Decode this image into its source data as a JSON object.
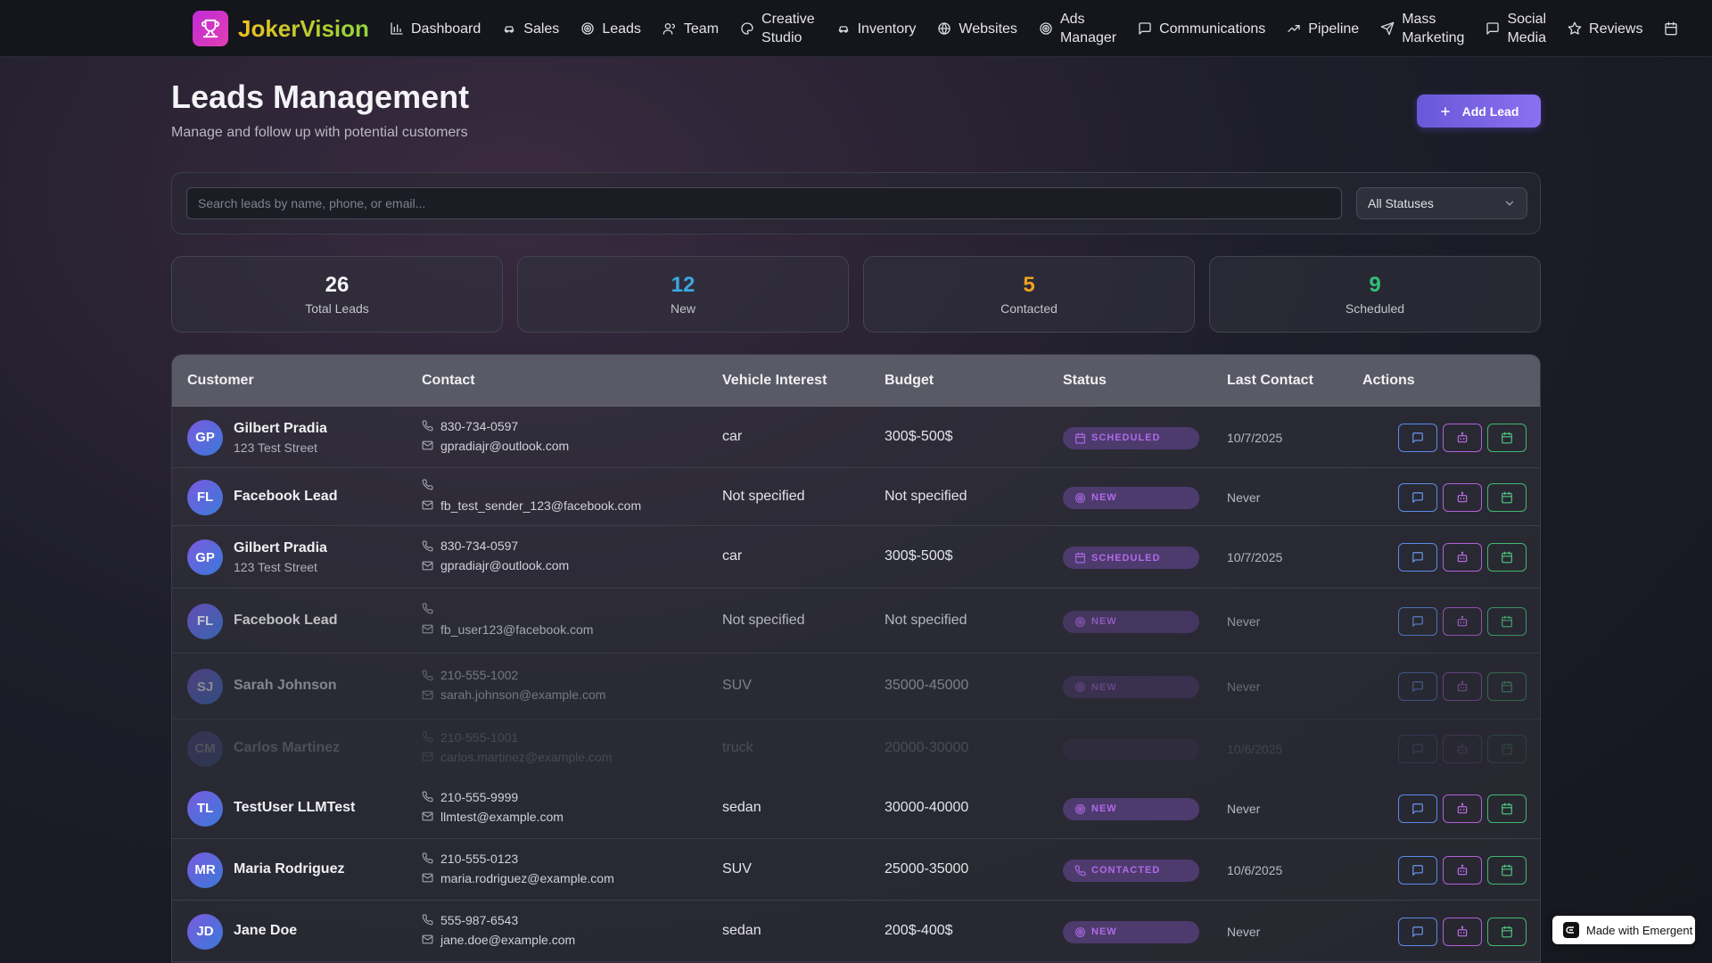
{
  "app": {
    "name": "JokerVision"
  },
  "nav": [
    {
      "label": "Dashboard",
      "icon": "bar-chart-icon"
    },
    {
      "label": "Sales",
      "icon": "car-icon"
    },
    {
      "label": "Leads",
      "icon": "target-icon"
    },
    {
      "label": "Team",
      "icon": "users-icon"
    },
    {
      "label": "Creative\nStudio",
      "icon": "palette-icon"
    },
    {
      "label": "Inventory",
      "icon": "car-icon"
    },
    {
      "label": "Websites",
      "icon": "globe-icon"
    },
    {
      "label": "Ads\nManager",
      "icon": "target-icon"
    },
    {
      "label": "Communications",
      "icon": "chat-icon"
    },
    {
      "label": "Pipeline",
      "icon": "trending-up-icon"
    },
    {
      "label": "Mass\nMarketing",
      "icon": "send-icon"
    },
    {
      "label": "Social\nMedia",
      "icon": "chat-icon"
    },
    {
      "label": "Reviews",
      "icon": "star-icon"
    },
    {
      "label": "",
      "icon": "calendar-icon"
    }
  ],
  "header": {
    "title": "Leads Management",
    "subtitle": "Manage and follow up with potential customers",
    "add_button": "Add Lead"
  },
  "search": {
    "placeholder": "Search leads by name, phone, or email...",
    "status_filter": "All Statuses"
  },
  "stats": [
    {
      "value": "26",
      "label": "Total Leads",
      "color": "#f4f4f8"
    },
    {
      "value": "12",
      "label": "New",
      "color": "#3aa8e0"
    },
    {
      "value": "5",
      "label": "Contacted",
      "color": "#f0a020"
    },
    {
      "value": "9",
      "label": "Scheduled",
      "color": "#30c078"
    }
  ],
  "table": {
    "columns": [
      "Customer",
      "Contact",
      "Vehicle Interest",
      "Budget",
      "Status",
      "Last Contact",
      "Actions"
    ],
    "rows": [
      {
        "initials": "GP",
        "name": "Gilbert Pradia",
        "address": "123 Test Street",
        "phone": "830-734-0597",
        "email": "gpradiajr@outlook.com",
        "vehicle": "car",
        "budget": "300$-500$",
        "status": "SCHEDULED",
        "status_icon": "calendar-icon",
        "last_contact": "10/7/2025"
      },
      {
        "initials": "FL",
        "name": "Facebook Lead",
        "address": "",
        "phone": "",
        "email": "fb_test_sender_123@facebook.com",
        "vehicle": "Not specified",
        "budget": "Not specified",
        "status": "NEW",
        "status_icon": "target-icon",
        "last_contact": "Never"
      },
      {
        "initials": "GP",
        "name": "Gilbert Pradia",
        "address": "123 Test Street",
        "phone": "830-734-0597",
        "email": "gpradiajr@outlook.com",
        "vehicle": "car",
        "budget": "300$-500$",
        "status": "SCHEDULED",
        "status_icon": "calendar-icon",
        "last_contact": "10/7/2025"
      },
      {
        "initials": "FL",
        "name": "Facebook Lead",
        "address": "",
        "phone": "",
        "email": "fb_user123@facebook.com",
        "vehicle": "Not specified",
        "budget": "Not specified",
        "status": "NEW",
        "status_icon": "target-icon",
        "last_contact": "Never"
      },
      {
        "initials": "SJ",
        "name": "Sarah Johnson",
        "address": "",
        "phone": "210-555-1002",
        "email": "sarah.johnson@example.com",
        "vehicle": "SUV",
        "budget": "35000-45000",
        "status": "NEW",
        "status_icon": "target-icon",
        "last_contact": "Never"
      },
      {
        "initials": "CM",
        "name": "Carlos Martinez",
        "address": "",
        "phone": "210-555-1001",
        "email": "carlos.martinez@example.com",
        "vehicle": "truck",
        "budget": "20000-30000",
        "status": "",
        "status_icon": "",
        "last_contact": "10/6/2025"
      },
      {
        "initials": "TL",
        "name": "TestUser LLMTest",
        "address": "",
        "phone": "210-555-9999",
        "email": "llmtest@example.com",
        "vehicle": "sedan",
        "budget": "30000-40000",
        "status": "NEW",
        "status_icon": "target-icon",
        "last_contact": "Never"
      },
      {
        "initials": "MR",
        "name": "Maria Rodriguez",
        "address": "",
        "phone": "210-555-0123",
        "email": "maria.rodriguez@example.com",
        "vehicle": "SUV",
        "budget": "25000-35000",
        "status": "CONTACTED",
        "status_icon": "phone-icon",
        "last_contact": "10/6/2025"
      },
      {
        "initials": "JD",
        "name": "Jane Doe",
        "address": "",
        "phone": "555-987-6543",
        "email": "jane.doe@example.com",
        "vehicle": "sedan",
        "budget": "200$-400$",
        "status": "NEW",
        "status_icon": "target-icon",
        "last_contact": "Never"
      }
    ]
  },
  "footer_badge": "Made with Emergent"
}
